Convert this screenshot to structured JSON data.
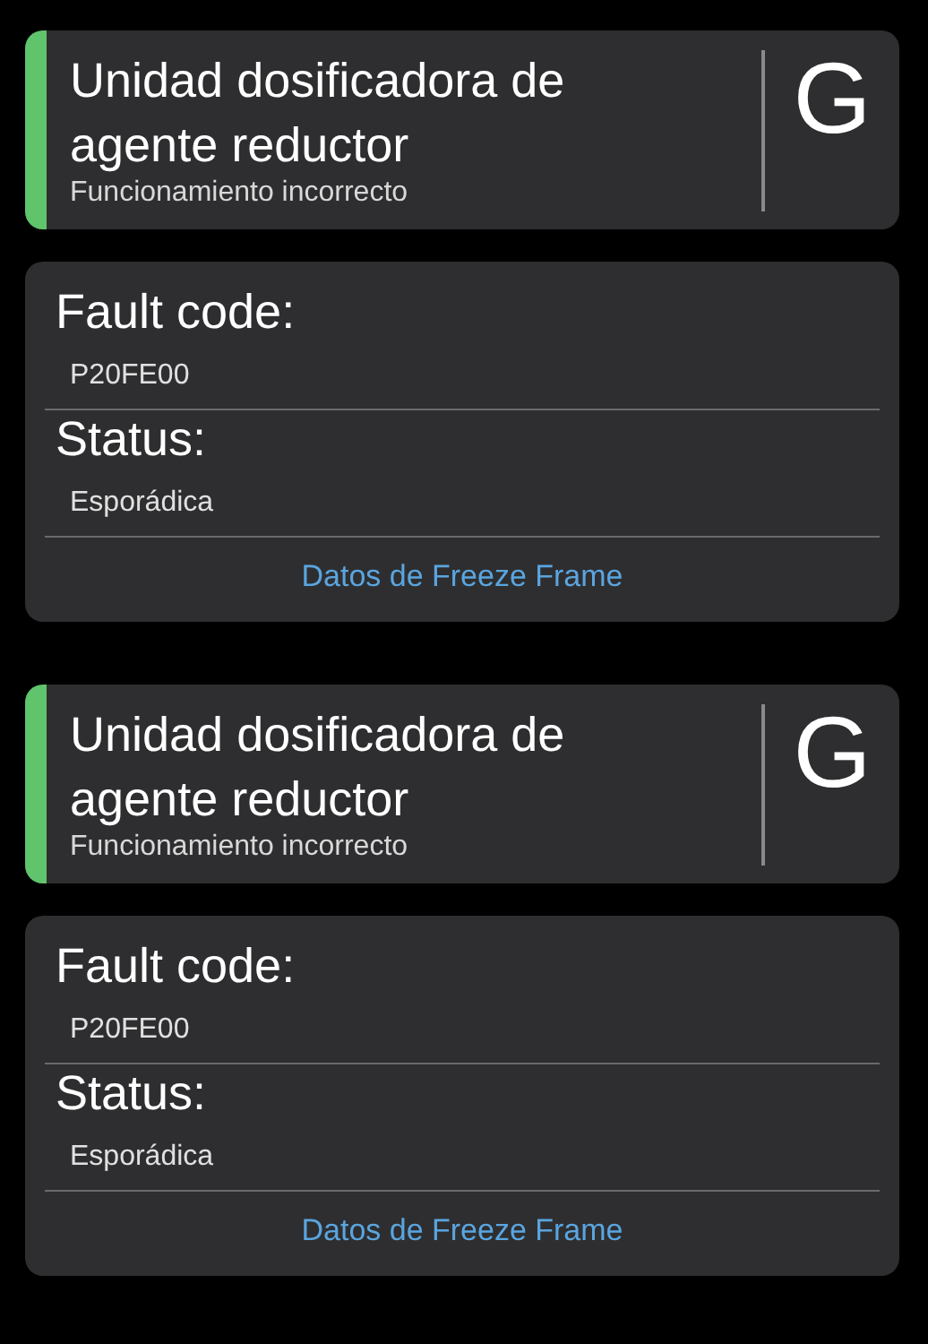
{
  "faults": [
    {
      "title": "Unidad dosificadora de agente reductor",
      "subtitle": "Funcionamiento incorrecto",
      "grade": "G",
      "color": "#5fc46c",
      "fields": [
        {
          "label": "Fault code:",
          "value": "P20FE00"
        },
        {
          "label": "Status:",
          "value": "Esporádica"
        }
      ],
      "link": "Datos de Freeze Frame"
    },
    {
      "title": "Unidad dosificadora de agente reductor",
      "subtitle": "Funcionamiento incorrecto",
      "grade": "G",
      "color": "#5fc46c",
      "fields": [
        {
          "label": "Fault code:",
          "value": "P20FE00"
        },
        {
          "label": "Status:",
          "value": "Esporádica"
        }
      ],
      "link": "Datos de Freeze Frame"
    }
  ]
}
